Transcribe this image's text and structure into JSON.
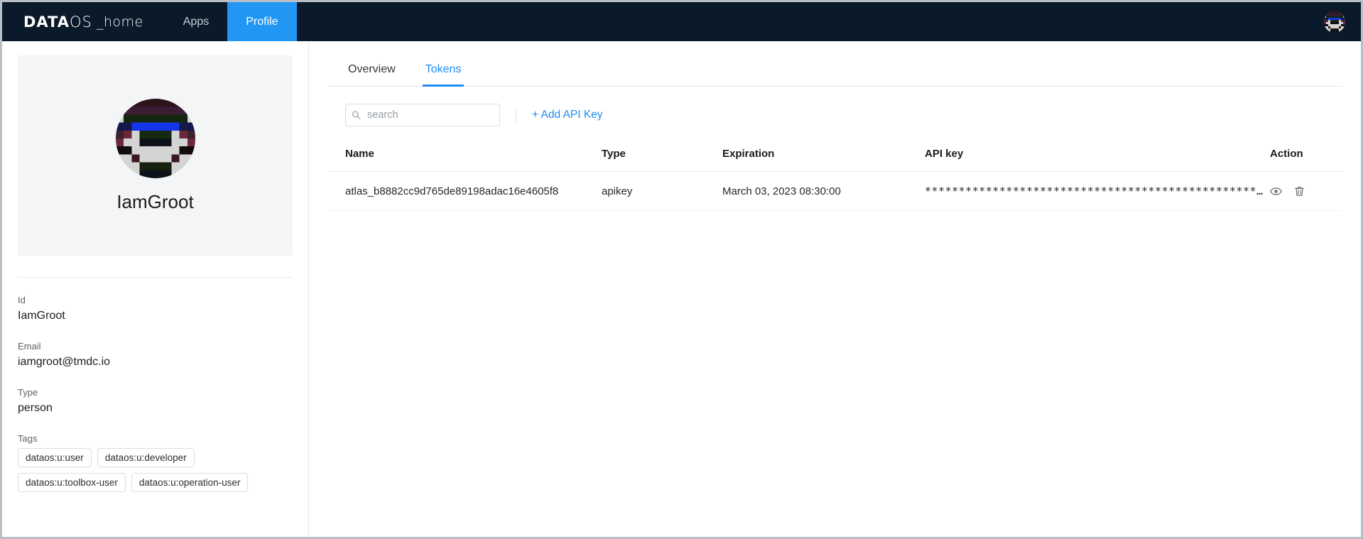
{
  "navbar": {
    "brand_data": "DATA",
    "brand_os": "OS",
    "brand_home": "_home",
    "items": [
      {
        "label": "Apps",
        "active": false
      },
      {
        "label": "Profile",
        "active": true
      }
    ],
    "avatar_name": "user-avatar",
    "accent_color": "#2196f3",
    "background_color": "#0a1a2a"
  },
  "profile": {
    "name": "IamGroot",
    "avatar_name": "profile-avatar",
    "fields": [
      {
        "label": "Id",
        "value": "IamGroot"
      },
      {
        "label": "Email",
        "value": "iamgroot@tmdc.io"
      },
      {
        "label": "Type",
        "value": "person"
      }
    ],
    "tags_label": "Tags",
    "tags": [
      "dataos:u:user",
      "dataos:u:developer",
      "dataos:u:toolbox-user",
      "dataos:u:operation-user"
    ]
  },
  "main": {
    "tabs": [
      {
        "label": "Overview",
        "active": false
      },
      {
        "label": "Tokens",
        "active": true
      }
    ],
    "toolbar": {
      "search_placeholder": "search",
      "search_value": "",
      "search_icon": "search-icon",
      "add_api_key_label": "+ Add API Key"
    },
    "table": {
      "columns": [
        "Name",
        "Type",
        "Expiration",
        "API key",
        "Action"
      ],
      "rows": [
        {
          "name": "atlas_b8882cc9d765de89198adac16e4605f8",
          "type": "apikey",
          "expiration": "March 03, 2023 08:30:00",
          "api_key": "*********************************************************",
          "actions": [
            "eye-icon",
            "trash-icon"
          ]
        }
      ]
    },
    "link_color": "#1f8df2"
  }
}
